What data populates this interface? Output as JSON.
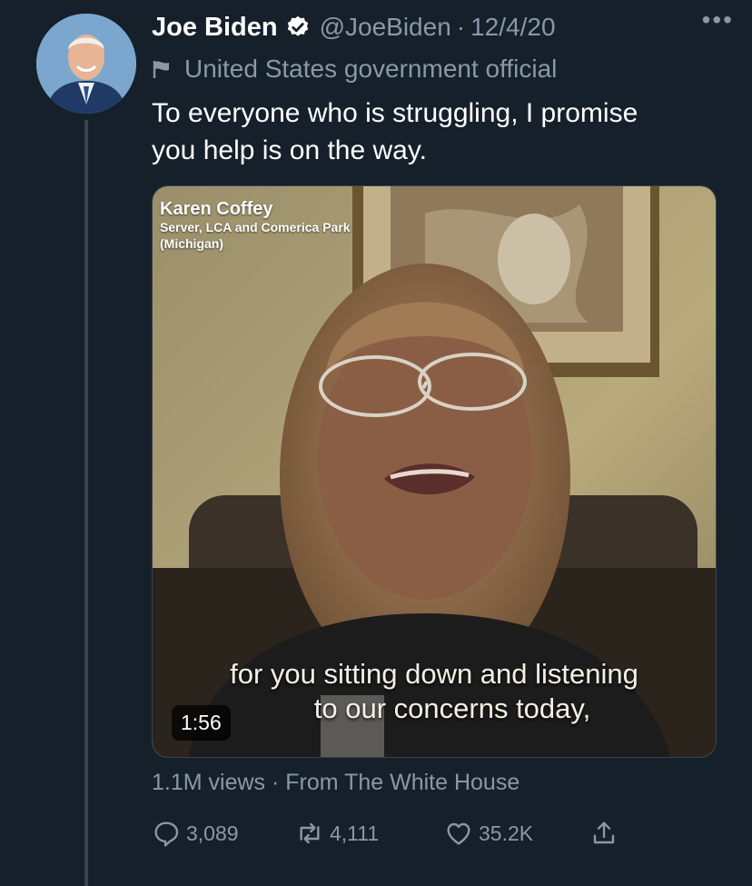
{
  "tweet": {
    "author_name": "Joe Biden",
    "handle": "@JoeBiden",
    "separator": "·",
    "date": "12/4/20",
    "label": "United States government official",
    "text_line1": "To everyone who is struggling, I promise",
    "text_line2": "you help is on the way.",
    "more_label": "•••"
  },
  "video": {
    "speaker_name": "Karen Coffey",
    "speaker_title": "Server, LCA and Comerica Park",
    "speaker_location": "(Michigan)",
    "caption_line1": "for you sitting down and listening",
    "caption_line2": "to our concerns today,",
    "duration": "1:56"
  },
  "stats": {
    "views": "1.1M views",
    "separator": "·",
    "source": "From The White House"
  },
  "actions": {
    "replies": "3,089",
    "retweets": "4,111",
    "likes": "35.2K"
  },
  "icons": {
    "verified": "verified-badge-icon",
    "flag": "government-flag-icon",
    "reply": "reply-icon",
    "retweet": "retweet-icon",
    "like": "heart-icon",
    "share": "share-icon"
  },
  "colors": {
    "background": "#15202b",
    "secondary_text": "#8899a6",
    "divider": "#38444d"
  }
}
